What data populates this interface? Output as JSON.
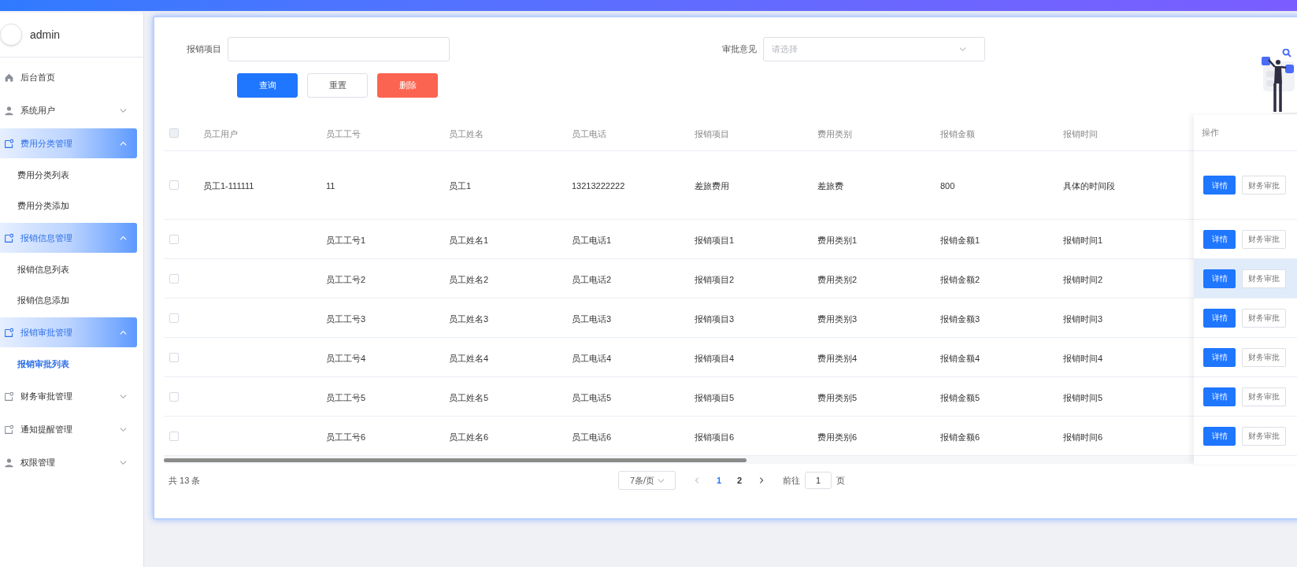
{
  "sidebar": {
    "user": "admin",
    "menu": [
      {
        "label": "后台首页",
        "kind": "home"
      },
      {
        "label": "系统用户",
        "kind": "user",
        "expanded": false
      },
      {
        "label": "费用分类管理",
        "kind": "doc",
        "expanded": true,
        "children": [
          {
            "label": "费用分类列表",
            "selected": false
          },
          {
            "label": "费用分类添加",
            "selected": false
          }
        ]
      },
      {
        "label": "报销信息管理",
        "kind": "doc",
        "expanded": true,
        "children": [
          {
            "label": "报销信息列表",
            "selected": false
          },
          {
            "label": "报销信息添加",
            "selected": false
          }
        ]
      },
      {
        "label": "报销审批管理",
        "kind": "doc",
        "expanded": true,
        "children": [
          {
            "label": "报销审批列表",
            "selected": true
          }
        ]
      },
      {
        "label": "财务审批管理",
        "kind": "doc",
        "expanded": false
      },
      {
        "label": "通知提醒管理",
        "kind": "doc",
        "expanded": false
      },
      {
        "label": "权限管理",
        "kind": "user",
        "expanded": false
      }
    ]
  },
  "filters": [
    {
      "label": "报销项目",
      "kind": "input"
    },
    {
      "label": "审批意见",
      "kind": "select",
      "placeholder": "请选择"
    }
  ],
  "buttons": [
    {
      "label": "查询",
      "kind": "primary"
    },
    {
      "label": "重置",
      "kind": "default"
    },
    {
      "label": "删除",
      "kind": "danger"
    }
  ],
  "table": {
    "header_checked": false,
    "columns": [
      "员工用户",
      "员工工号",
      "员工姓名",
      "员工电话",
      "报销项目",
      "费用类别",
      "报销金额",
      "报销时间"
    ],
    "action_column": "操作",
    "rows": [
      {
        "checked": false,
        "highlighted": false,
        "cells": [
          "员工1-111111",
          "11",
          "员工1",
          "13213222222",
          "差旅费用",
          "差旅费",
          "800",
          "具体的时间段"
        ],
        "actions": [
          {
            "label": "详情",
            "kind": "primary"
          },
          {
            "label": "财务审批",
            "kind": "default"
          }
        ]
      },
      {
        "checked": false,
        "highlighted": false,
        "cells": [
          null,
          "员工工号1",
          "员工姓名1",
          "员工电话1",
          "报销项目1",
          "费用类别1",
          "报销金额1",
          "报销时间1"
        ],
        "actions": [
          {
            "label": "详情",
            "kind": "primary"
          },
          {
            "label": "财务审批",
            "kind": "default"
          }
        ]
      },
      {
        "checked": false,
        "highlighted": true,
        "cells": [
          null,
          "员工工号2",
          "员工姓名2",
          "员工电话2",
          "报销项目2",
          "费用类别2",
          "报销金额2",
          "报销时间2"
        ],
        "actions": [
          {
            "label": "详情",
            "kind": "primary"
          },
          {
            "label": "财务审批",
            "kind": "default"
          }
        ]
      },
      {
        "checked": false,
        "highlighted": false,
        "cells": [
          null,
          "员工工号3",
          "员工姓名3",
          "员工电话3",
          "报销项目3",
          "费用类别3",
          "报销金额3",
          "报销时间3"
        ],
        "actions": [
          {
            "label": "详情",
            "kind": "primary"
          },
          {
            "label": "财务审批",
            "kind": "default"
          }
        ]
      },
      {
        "checked": false,
        "highlighted": false,
        "cells": [
          null,
          "员工工号4",
          "员工姓名4",
          "员工电话4",
          "报销项目4",
          "费用类别4",
          "报销金额4",
          "报销时间4"
        ],
        "actions": [
          {
            "label": "详情",
            "kind": "primary"
          },
          {
            "label": "财务审批",
            "kind": "default"
          }
        ]
      },
      {
        "checked": false,
        "highlighted": false,
        "cells": [
          null,
          "员工工号5",
          "员工姓名5",
          "员工电话5",
          "报销项目5",
          "费用类别5",
          "报销金额5",
          "报销时间5"
        ],
        "actions": [
          {
            "label": "详情",
            "kind": "primary"
          },
          {
            "label": "财务审批",
            "kind": "default"
          }
        ]
      },
      {
        "checked": false,
        "highlighted": false,
        "cells": [
          null,
          "员工工号6",
          "员工姓名6",
          "员工电话6",
          "报销项目6",
          "费用类别6",
          "报销金额6",
          "报销时间6"
        ],
        "actions": [
          {
            "label": "详情",
            "kind": "primary"
          },
          {
            "label": "财务审批",
            "kind": "default"
          }
        ]
      }
    ]
  },
  "pagination": {
    "total": "共 13 条",
    "page_size": "7条/页",
    "pages": [
      {
        "label": "1",
        "selected": true
      },
      {
        "label": "2",
        "selected": false
      }
    ],
    "goto_label": "前往",
    "goto_value": "1",
    "goto_suffix": "页"
  }
}
